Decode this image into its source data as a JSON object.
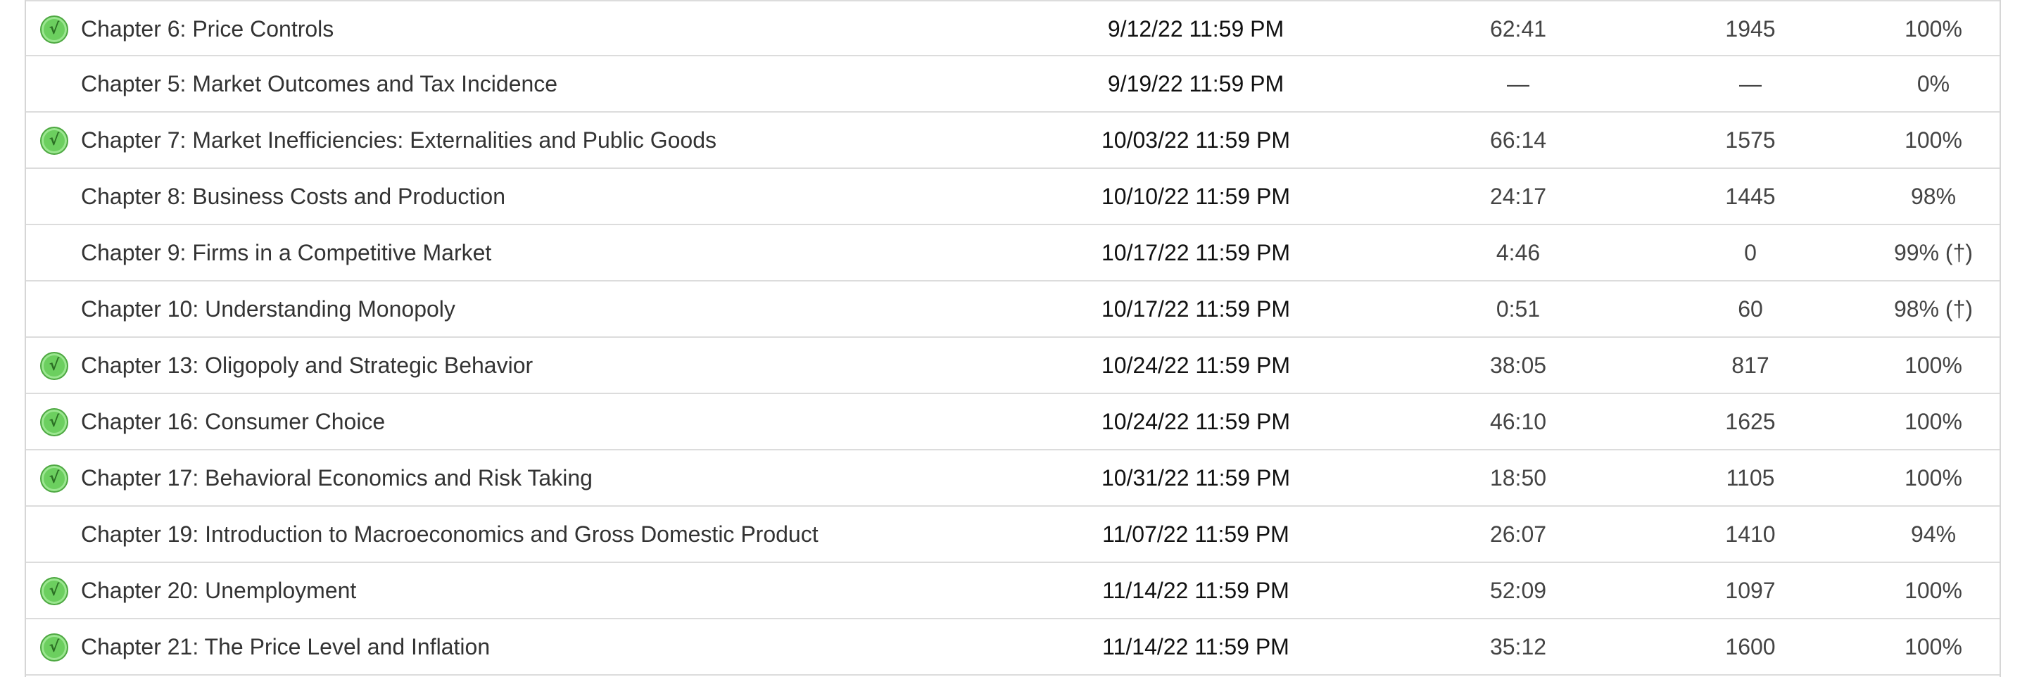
{
  "rows": [
    {
      "completed": true,
      "name": "Chapter 6: Price Controls",
      "due": "9/12/22 11:59 PM",
      "time": "62:41",
      "score": "1945",
      "percent": "100%"
    },
    {
      "completed": false,
      "name": "Chapter 5: Market Outcomes and Tax Incidence",
      "due": "9/19/22 11:59 PM",
      "time": "—",
      "score": "—",
      "percent": "0%"
    },
    {
      "completed": true,
      "name": "Chapter 7: Market Inefficiencies: Externalities and Public Goods",
      "due": "10/03/22 11:59 PM",
      "time": "66:14",
      "score": "1575",
      "percent": "100%"
    },
    {
      "completed": false,
      "name": "Chapter 8: Business Costs and Production",
      "due": "10/10/22 11:59 PM",
      "time": "24:17",
      "score": "1445",
      "percent": "98%"
    },
    {
      "completed": false,
      "name": "Chapter 9: Firms in a Competitive Market",
      "due": "10/17/22 11:59 PM",
      "time": "4:46",
      "score": "0",
      "percent": "99% (†)"
    },
    {
      "completed": false,
      "name": "Chapter 10: Understanding Monopoly",
      "due": "10/17/22 11:59 PM",
      "time": "0:51",
      "score": "60",
      "percent": "98% (†)"
    },
    {
      "completed": true,
      "name": "Chapter 13: Oligopoly and Strategic Behavior",
      "due": "10/24/22 11:59 PM",
      "time": "38:05",
      "score": "817",
      "percent": "100%"
    },
    {
      "completed": true,
      "name": "Chapter 16: Consumer Choice",
      "due": "10/24/22 11:59 PM",
      "time": "46:10",
      "score": "1625",
      "percent": "100%"
    },
    {
      "completed": true,
      "name": "Chapter 17: Behavioral Economics and Risk Taking",
      "due": "10/31/22 11:59 PM",
      "time": "18:50",
      "score": "1105",
      "percent": "100%"
    },
    {
      "completed": false,
      "name": "Chapter 19: Introduction to Macroeconomics and Gross Domestic Product",
      "due": "11/07/22 11:59 PM",
      "time": "26:07",
      "score": "1410",
      "percent": "94%"
    },
    {
      "completed": true,
      "name": "Chapter 20: Unemployment",
      "due": "11/14/22 11:59 PM",
      "time": "52:09",
      "score": "1097",
      "percent": "100%"
    },
    {
      "completed": true,
      "name": "Chapter 21: The Price Level and Inflation",
      "due": "11/14/22 11:59 PM",
      "time": "35:12",
      "score": "1600",
      "percent": "100%"
    }
  ],
  "icons": {
    "completed": "check-circle-icon"
  },
  "colors": {
    "check_fill": "#6ccf5f",
    "row_border": "#dcdcdc",
    "text": "#333333"
  }
}
